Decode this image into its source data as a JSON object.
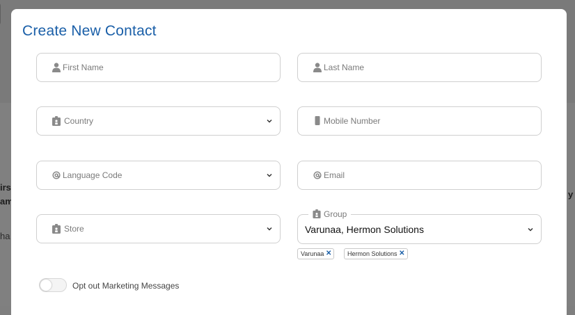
{
  "background": {
    "left_text_1": "irst",
    "left_text_2": "am",
    "left_text_3": "ha",
    "right_text_1": "y"
  },
  "modal": {
    "title": "Create New Contact",
    "first_name": {
      "placeholder": "First Name",
      "icon": "user-icon"
    },
    "last_name": {
      "placeholder": "Last Name",
      "icon": "user-icon"
    },
    "country": {
      "placeholder": "Country",
      "icon": "id-badge-icon"
    },
    "mobile": {
      "placeholder": "Mobile Number",
      "icon": "mobile-icon"
    },
    "language": {
      "placeholder": "Language Code",
      "icon": "at-icon"
    },
    "email": {
      "placeholder": "Email",
      "icon": "at-icon"
    },
    "store": {
      "placeholder": "Store",
      "icon": "id-badge-icon"
    },
    "group": {
      "label": "Group",
      "icon": "id-badge-icon",
      "value": "Varunaa, Hermon Solutions",
      "chips": [
        "Varunaa",
        "Hermon Solutions"
      ]
    },
    "opt_out": {
      "label": "Opt out Marketing Messages",
      "checked": false
    }
  },
  "colors": {
    "title": "#1a5fa8",
    "border": "#cfcfcf",
    "placeholder": "#7a7a7a"
  }
}
